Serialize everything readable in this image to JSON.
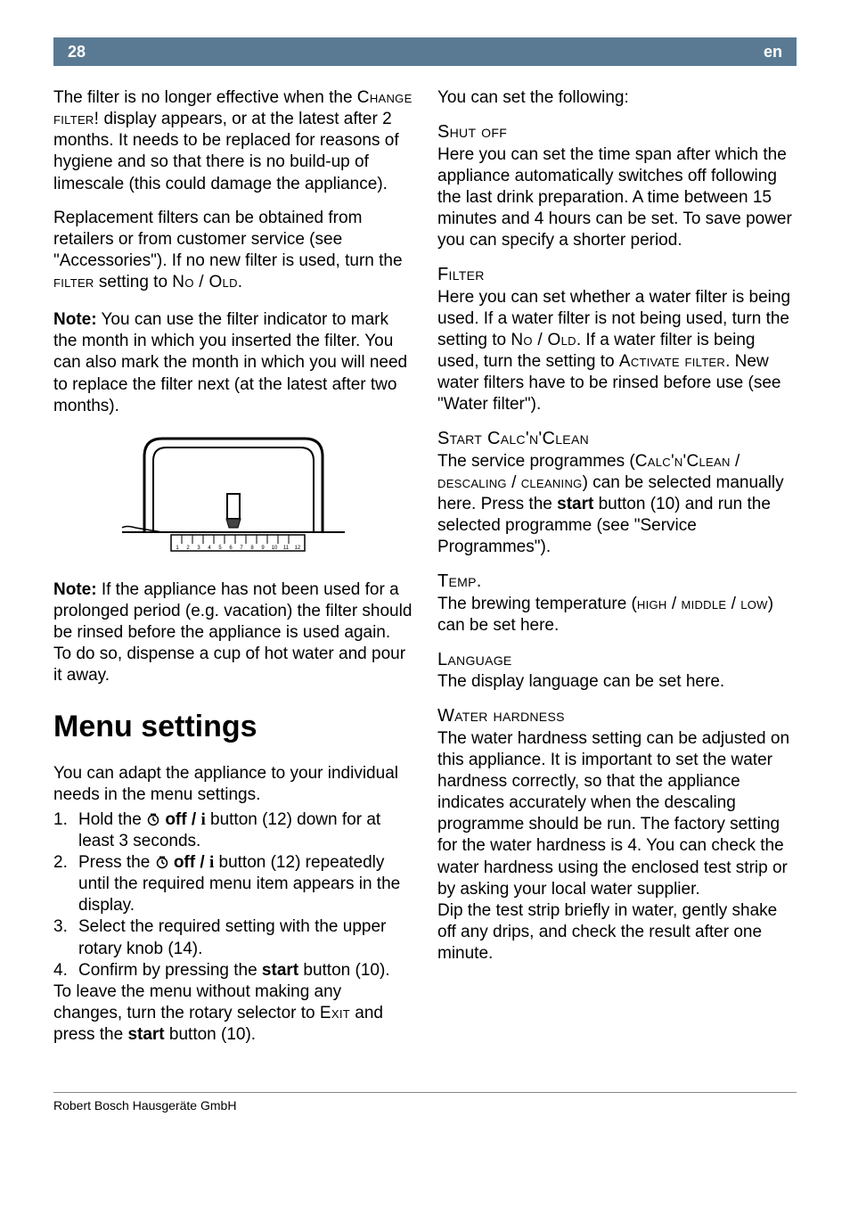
{
  "header": {
    "page_num": "28",
    "lang": "en"
  },
  "left": {
    "p1a": "The filter is no longer effective when the ",
    "p1_sc": "Change filter!",
    "p1b": " display appears, or at the latest after 2 months. It needs to be replaced for reasons of hygiene and so that there is no build-up of limescale (this could damage the appliance).",
    "p2a": "Replacement filters can be obtained from retailers or from customer service (see \"Accessories\"). If no new filter is used, turn the ",
    "p2_sc1": "filter",
    "p2b": " setting to ",
    "p2_sc2": "No / Old",
    "p2c": ".",
    "note1_label": "Note:",
    "note1": " You can use the filter indicator to mark the month in which you inserted the filter. You can also mark the month in which you will need to replace the filter next (at the latest after two months).",
    "note2_label": "Note:",
    "note2": " If the appliance has not been used for a prolonged period (e.g. vacation) the filter should be rinsed before the appliance is used again. To do so, dispense a cup of hot water and pour it away.",
    "menu_heading": "Menu settings",
    "menu_intro": "You can adapt the appliance to your individual needs in the menu settings.",
    "s1a": "Hold the ",
    "s1_bold": "off / ",
    "s1b": " button (12) down for at least 3 seconds.",
    "s2a": "Press the ",
    "s2_bold": "off / ",
    "s2b": " button (12) repeatedly until the required menu item appears in the display.",
    "s3": "Select the required setting with the upper rotary knob (14).",
    "s4a": "Confirm by pressing the ",
    "s4_bold": "start",
    "s4b": " button (10).",
    "menu_out_a": "To leave the menu without making any changes, turn the rotary selector to ",
    "menu_out_sc": "Exit",
    "menu_out_b": " and press the ",
    "menu_out_bold": "start",
    "menu_out_c": " button (10)."
  },
  "right": {
    "intro": "You can set the following:",
    "shut_head": "Shut off",
    "shut_body": "Here you can set the time span after which the appliance automatically switches off following the last drink preparation. A time between 15 minutes and 4 hours can be set. To save power you can specify a shorter period.",
    "filter_head": "Filter",
    "filter_a": "Here you can set whether a water filter is being used. If a water filter is not being used, turn the setting to ",
    "filter_sc1": "No / Old",
    "filter_b": ". If a water filter is being used, turn the setting to ",
    "filter_sc2": "Activate filter",
    "filter_c": ". New water filters have to be rinsed before use (see \"Water filter\").",
    "calc_head": "Start Calc'n'Clean",
    "calc_a": "The service programmes (",
    "calc_sc1": "Calc'n'Clean",
    "calc_b": " / ",
    "calc_sc2": "descaling",
    "calc_c": " / ",
    "calc_sc3": "cleaning",
    "calc_d": ") can be selected manually here. Press the ",
    "calc_bold": "start",
    "calc_e": " button (10) and run the selected programme (see \"Service Programmes\").",
    "temp_head": "Temp.",
    "temp_a": "The brewing temperature (",
    "temp_sc1": "high",
    "temp_b": " / ",
    "temp_sc2": "middle",
    "temp_c": " / ",
    "temp_sc3": "low",
    "temp_d": ") can be set here.",
    "lang_head": "Language",
    "lang_body": "The display language can be set here.",
    "water_head": "Water hardness",
    "water_body1": "The water hardness setting can be adjusted on this appliance. It is important to set the water hardness correctly, so that the appliance indicates accurately when the descaling programme should be run. The factory setting for the water hardness is 4. You can check the water hardness using the enclosed test strip or by asking your local water supplier.",
    "water_body2": "Dip the test strip briefly in water, gently shake off any drips, and check the result after one minute."
  },
  "footer": "Robert Bosch Hausgeräte GmbH"
}
